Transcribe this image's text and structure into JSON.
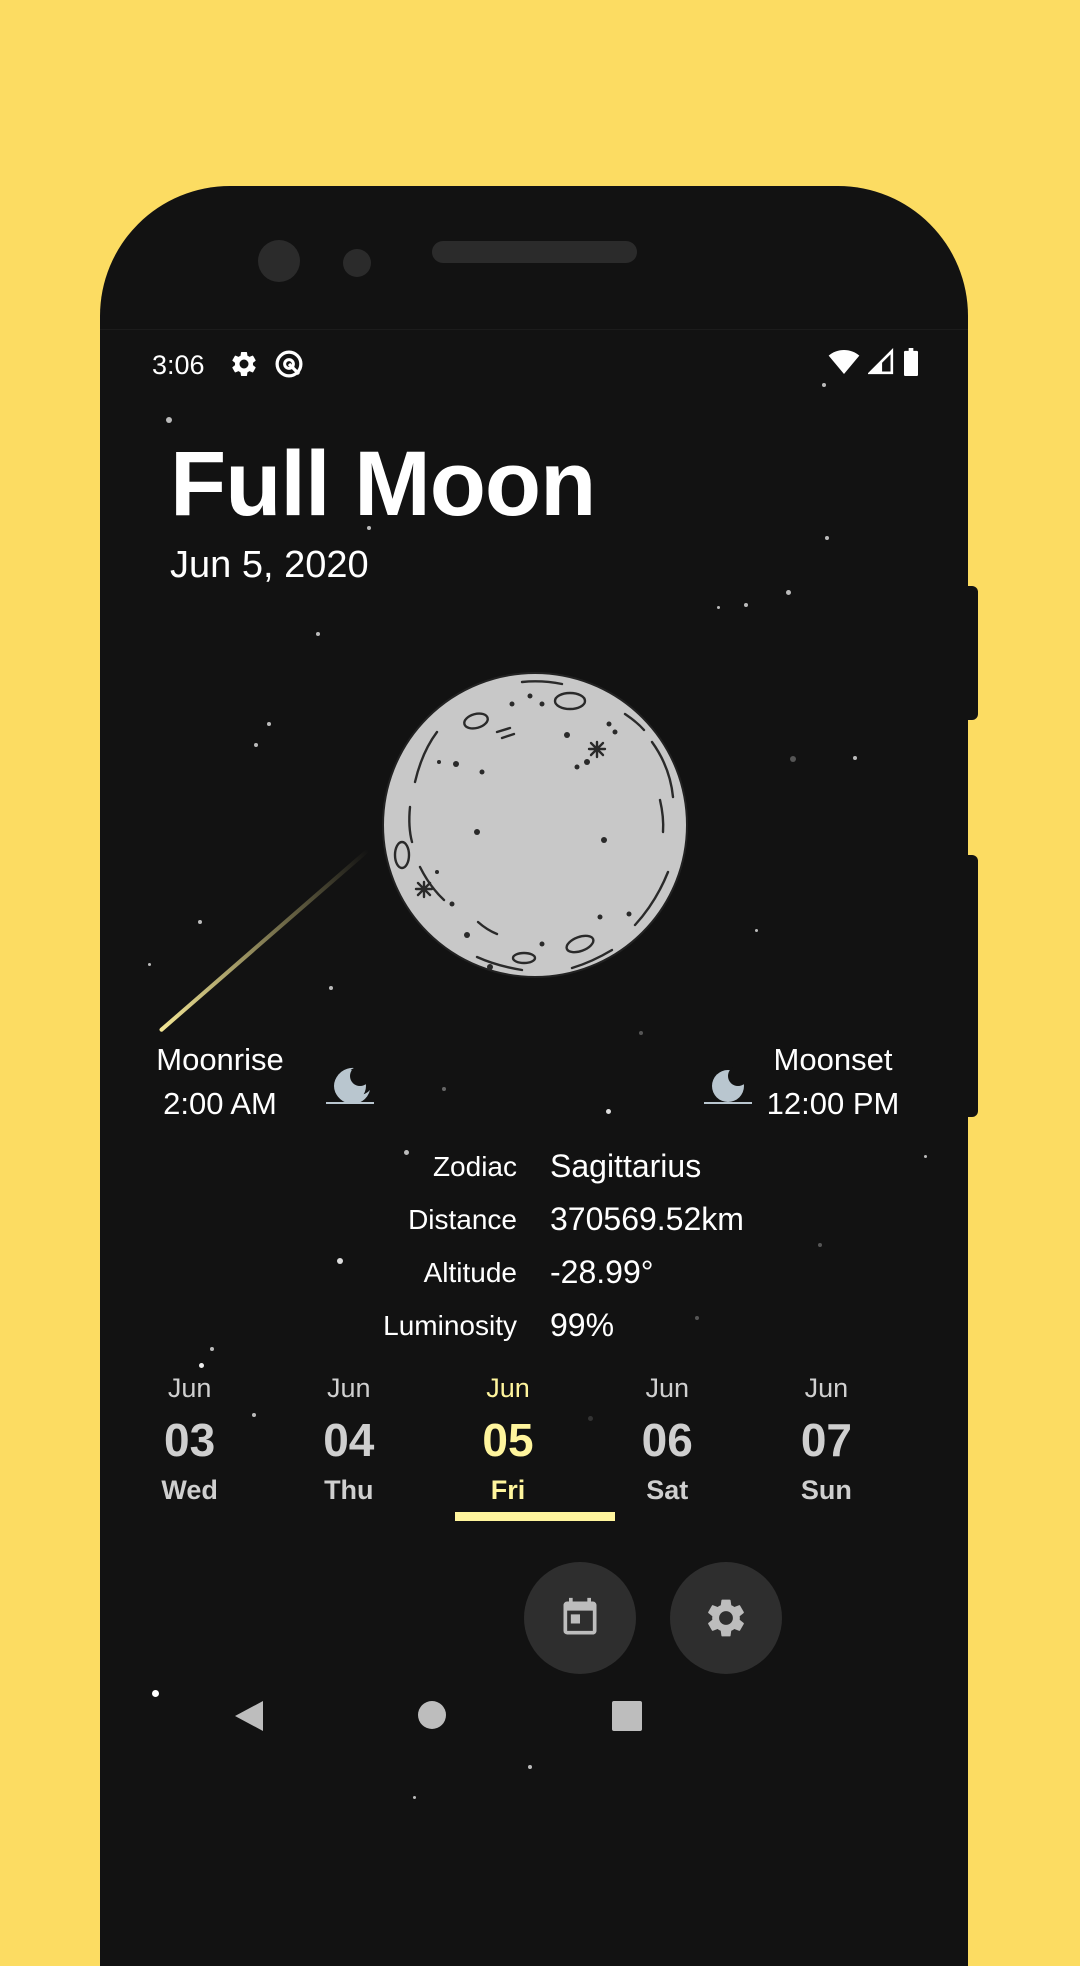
{
  "status_bar": {
    "time": "3:06"
  },
  "header": {
    "title": "Full Moon",
    "date": "Jun 5, 2020"
  },
  "rise_set": {
    "moonrise_label": "Moonrise",
    "moonrise_time": "2:00 AM",
    "moonset_label": "Moonset",
    "moonset_time": "12:00 PM"
  },
  "info": [
    {
      "key": "Zodiac",
      "value": "Sagittarius"
    },
    {
      "key": "Distance",
      "value": "370569.52km"
    },
    {
      "key": "Altitude",
      "value": "-28.99°"
    },
    {
      "key": "Luminosity",
      "value": "99%"
    }
  ],
  "days": [
    {
      "month": "Jun",
      "day": "03",
      "weekday": "Wed"
    },
    {
      "month": "Jun",
      "day": "04",
      "weekday": "Thu"
    },
    {
      "month": "Jun",
      "day": "05",
      "weekday": "Fri"
    },
    {
      "month": "Jun",
      "day": "06",
      "weekday": "Sat"
    },
    {
      "month": "Jun",
      "day": "07",
      "weekday": "Sun"
    }
  ],
  "selected_day_index": 2,
  "colors": {
    "background": "#fcdc62",
    "screen": "#121212",
    "accent": "#fff59d",
    "moon": "#c8c8c8"
  },
  "icons": {
    "status_left": [
      "settings-gear-icon",
      "vpn-key-icon"
    ],
    "status_right": [
      "wifi-icon",
      "cellular-signal-icon",
      "battery-icon"
    ],
    "fab": [
      "calendar-icon",
      "settings-gear-icon"
    ],
    "nav": [
      "back-icon",
      "home-icon",
      "recents-icon"
    ]
  }
}
